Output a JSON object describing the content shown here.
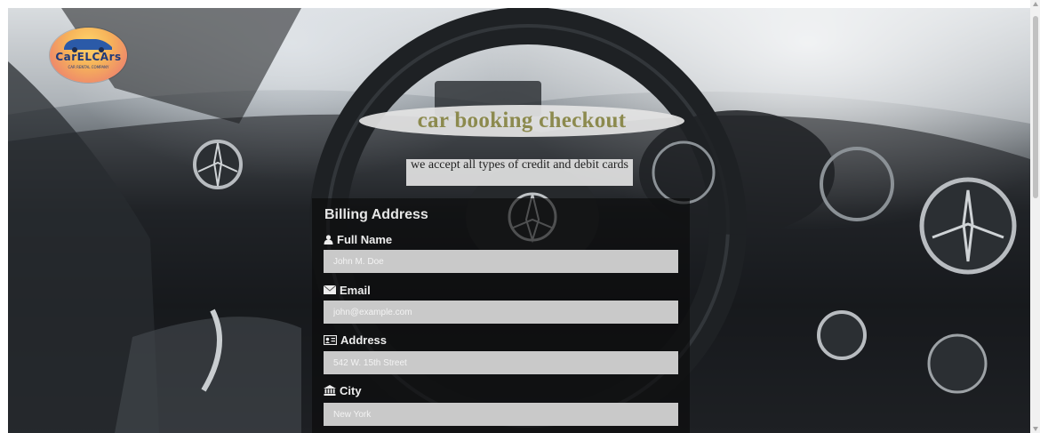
{
  "brand": {
    "logo_text": "CarELCArs",
    "logo_subtext": "CAR RENTAL COMPANY"
  },
  "page": {
    "title": "car booking checkout",
    "card_note": "we accept all types of credit and debit cards"
  },
  "billing": {
    "heading": "Billing Address",
    "fields": [
      {
        "label": "Full Name",
        "icon": "user-icon",
        "placeholder": "John M. Doe"
      },
      {
        "label": "Email",
        "icon": "envelope-icon",
        "placeholder": "john@example.com"
      },
      {
        "label": "Address",
        "icon": "address-card-icon",
        "placeholder": "542 W. 15th Street"
      },
      {
        "label": "City",
        "icon": "institution-icon",
        "placeholder": "New York"
      }
    ]
  },
  "colors": {
    "title": "#8c8a4e",
    "panel": "#0a0a0a",
    "input": "#c9c9c9"
  }
}
